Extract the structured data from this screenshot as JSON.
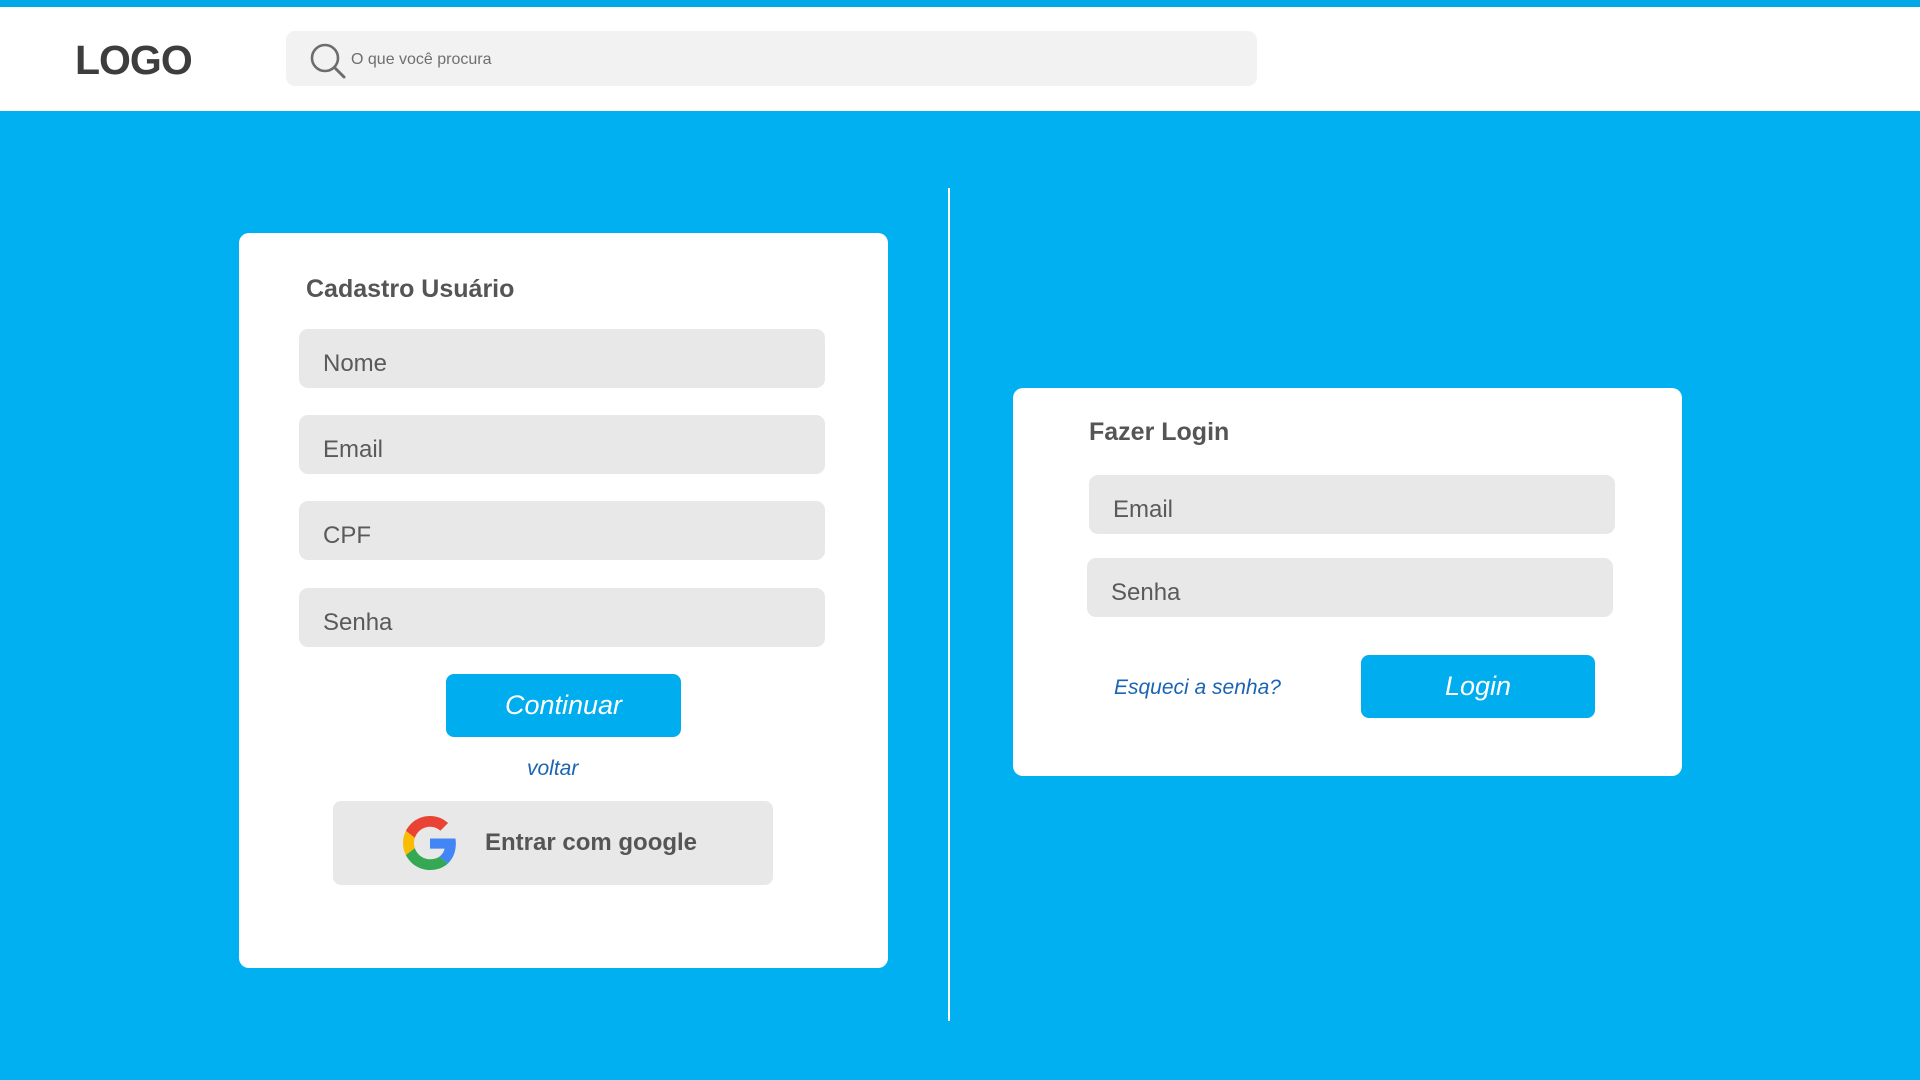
{
  "header": {
    "logo": "LOGO",
    "search_placeholder": "O que você procura"
  },
  "register": {
    "title": "Cadastro Usuário",
    "fields": {
      "nome": "Nome",
      "email": "Email",
      "cpf": "CPF",
      "senha": "Senha"
    },
    "continue_label": "Continuar",
    "back_label": "voltar",
    "google_label": "Entrar com google"
  },
  "login": {
    "title": "Fazer Login",
    "fields": {
      "email": "Email",
      "senha": "Senha"
    },
    "forgot_label": "Esqueci a senha?",
    "login_label": "Login"
  },
  "colors": {
    "background": "#00b0f0",
    "primary_button": "#00adef",
    "link": "#1b64b3",
    "field": "#e8e8e8"
  }
}
